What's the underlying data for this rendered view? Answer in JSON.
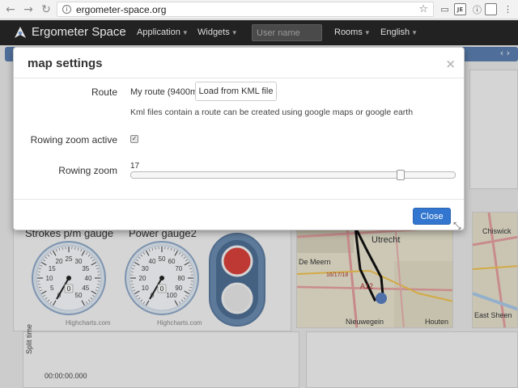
{
  "browser": {
    "url": "ergometer-space.org",
    "icons": [
      "back-icon",
      "forward-icon",
      "reload-icon",
      "info-icon",
      "star-icon",
      "cast-icon",
      "extension-icon"
    ]
  },
  "navbar": {
    "brand": "Ergometer Space",
    "menu": {
      "application": "Application",
      "widgets": "Widgets",
      "rooms": "Rooms",
      "language": "English"
    },
    "user_placeholder": "User name"
  },
  "modal": {
    "title": "map settings",
    "route_label": "Route",
    "route_value": "My route (9400m )",
    "kml_button": "Load from KML file",
    "help": "Kml files contain a route can be created using google maps or google earth",
    "rowing_zoom_active_label": "Rowing zoom active",
    "rowing_zoom_active": true,
    "rowing_zoom_label": "Rowing zoom",
    "rowing_zoom_value": "17",
    "rowing_zoom_level_fraction": 0.84,
    "close_button": "Close"
  },
  "dashboard": {
    "strokes_title": "Strokes p/m gauge",
    "power_title": "Power gauge2",
    "credits": "Highcharts.com",
    "split_time_label": "Split time",
    "split_time_value": "00:00:00.000",
    "strokes_ticks": [
      "0",
      "5",
      "10",
      "15",
      "20",
      "25",
      "30",
      "35",
      "40",
      "45",
      "50"
    ],
    "strokes_value": "0",
    "power_ticks": [
      "0",
      "10",
      "20",
      "30",
      "40",
      "50",
      "60",
      "70",
      "80",
      "90",
      "100"
    ],
    "power_value": "0",
    "map_labels": {
      "utrecht": "Utrecht",
      "de_meern": "De Meern",
      "nieuwegein": "Nieuwegein",
      "houten": "Houten",
      "a12": "A12",
      "chiswick": "Chiswick",
      "east_sheen": "East Sheen",
      "road": "16/17/18"
    }
  }
}
